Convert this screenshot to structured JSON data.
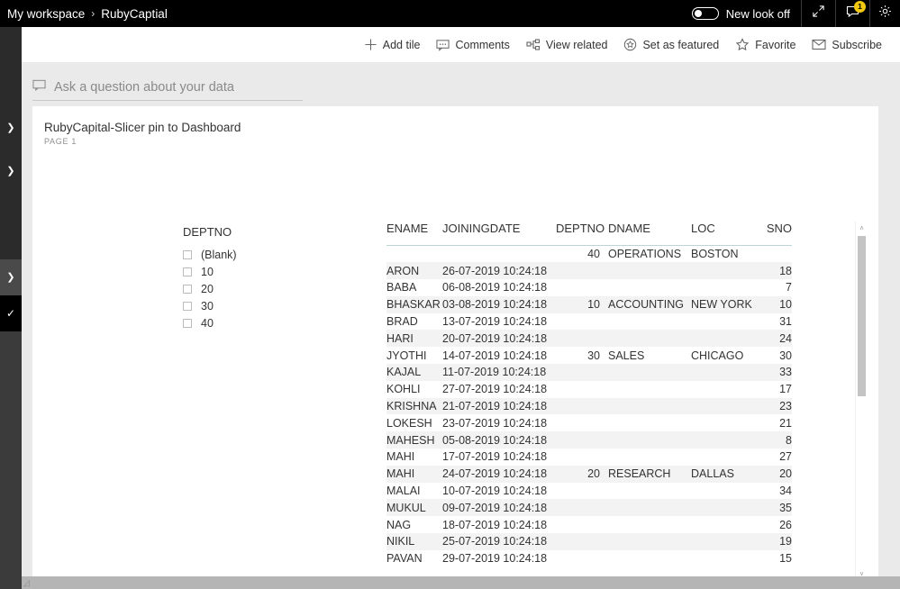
{
  "topbar": {
    "breadcrumb": {
      "workspace": "My workspace",
      "separator": "›",
      "item": "RubyCaptial"
    },
    "toggle": {
      "label": "New look off",
      "state": "off"
    },
    "icons": {
      "fullscreen": "expand-icon",
      "announcements": "announcements-icon",
      "settings": "gear-icon"
    },
    "notification_count": "1",
    "badge_color": "#f2c811"
  },
  "commandbar": {
    "items": [
      {
        "label": "Add tile",
        "icon": "plus-icon"
      },
      {
        "label": "Comments",
        "icon": "comment-icon"
      },
      {
        "label": "View related",
        "icon": "view-related-icon"
      },
      {
        "label": "Set as featured",
        "icon": "featured-icon"
      },
      {
        "label": "Favorite",
        "icon": "star-icon"
      },
      {
        "label": "Subscribe",
        "icon": "envelope-icon"
      }
    ]
  },
  "qna": {
    "placeholder": "Ask a question about your data",
    "icon": "chat-bubble-icon"
  },
  "tile": {
    "title": "RubyCapital-Slicer pin to Dashboard",
    "subtitle": "PAGE 1"
  },
  "slicer": {
    "title": "DEPTNO",
    "items": [
      {
        "label": "(Blank)",
        "checked": false
      },
      {
        "label": "10",
        "checked": false
      },
      {
        "label": "20",
        "checked": false
      },
      {
        "label": "30",
        "checked": false
      },
      {
        "label": "40",
        "checked": false
      }
    ]
  },
  "table": {
    "columns": [
      "ENAME",
      "JOININGDATE",
      "DEPTNO",
      "DNAME",
      "LOC",
      "SNO"
    ],
    "rows": [
      {
        "ename": "",
        "joiningdate": "",
        "deptno": "40",
        "dname": "OPERATIONS",
        "loc": "BOSTON",
        "sno": ""
      },
      {
        "ename": "ARON",
        "joiningdate": "26-07-2019 10:24:18",
        "deptno": "",
        "dname": "",
        "loc": "",
        "sno": "18"
      },
      {
        "ename": "BABA",
        "joiningdate": "06-08-2019 10:24:18",
        "deptno": "",
        "dname": "",
        "loc": "",
        "sno": "7"
      },
      {
        "ename": "BHASKAR",
        "joiningdate": "03-08-2019 10:24:18",
        "deptno": "10",
        "dname": "ACCOUNTING",
        "loc": "NEW YORK",
        "sno": "10"
      },
      {
        "ename": "BRAD",
        "joiningdate": "13-07-2019 10:24:18",
        "deptno": "",
        "dname": "",
        "loc": "",
        "sno": "31"
      },
      {
        "ename": "HARI",
        "joiningdate": "20-07-2019 10:24:18",
        "deptno": "",
        "dname": "",
        "loc": "",
        "sno": "24"
      },
      {
        "ename": "JYOTHI",
        "joiningdate": "14-07-2019 10:24:18",
        "deptno": "30",
        "dname": "SALES",
        "loc": "CHICAGO",
        "sno": "30"
      },
      {
        "ename": "KAJAL",
        "joiningdate": "11-07-2019 10:24:18",
        "deptno": "",
        "dname": "",
        "loc": "",
        "sno": "33"
      },
      {
        "ename": "KOHLI",
        "joiningdate": "27-07-2019 10:24:18",
        "deptno": "",
        "dname": "",
        "loc": "",
        "sno": "17"
      },
      {
        "ename": "KRISHNA",
        "joiningdate": "21-07-2019 10:24:18",
        "deptno": "",
        "dname": "",
        "loc": "",
        "sno": "23"
      },
      {
        "ename": "LOKESH",
        "joiningdate": "23-07-2019 10:24:18",
        "deptno": "",
        "dname": "",
        "loc": "",
        "sno": "21"
      },
      {
        "ename": "MAHESH",
        "joiningdate": "05-08-2019 10:24:18",
        "deptno": "",
        "dname": "",
        "loc": "",
        "sno": "8"
      },
      {
        "ename": "MAHI",
        "joiningdate": "17-07-2019 10:24:18",
        "deptno": "",
        "dname": "",
        "loc": "",
        "sno": "27"
      },
      {
        "ename": "MAHI",
        "joiningdate": "24-07-2019 10:24:18",
        "deptno": "20",
        "dname": "RESEARCH",
        "loc": "DALLAS",
        "sno": "20"
      },
      {
        "ename": "MALAI",
        "joiningdate": "10-07-2019 10:24:18",
        "deptno": "",
        "dname": "",
        "loc": "",
        "sno": "34"
      },
      {
        "ename": "MUKUL",
        "joiningdate": "09-07-2019 10:24:18",
        "deptno": "",
        "dname": "",
        "loc": "",
        "sno": "35"
      },
      {
        "ename": "NAG",
        "joiningdate": "18-07-2019 10:24:18",
        "deptno": "",
        "dname": "",
        "loc": "",
        "sno": "26"
      },
      {
        "ename": "NIKIL",
        "joiningdate": "25-07-2019 10:24:18",
        "deptno": "",
        "dname": "",
        "loc": "",
        "sno": "19"
      },
      {
        "ename": "PAVAN",
        "joiningdate": "29-07-2019 10:24:18",
        "deptno": "",
        "dname": "",
        "loc": "",
        "sno": "15"
      }
    ]
  },
  "sidebar": {
    "items": [
      {
        "icon": "chevron-right-icon",
        "state": "normal"
      },
      {
        "icon": "chevron-right-icon",
        "state": "normal"
      },
      {
        "icon": "chevron-right-icon",
        "state": "hover"
      },
      {
        "icon": "pencil-icon",
        "state": "selected"
      }
    ]
  },
  "scrollbars": {
    "vertical": {
      "up_arrow": "∧",
      "down_arrow": "∨"
    }
  }
}
